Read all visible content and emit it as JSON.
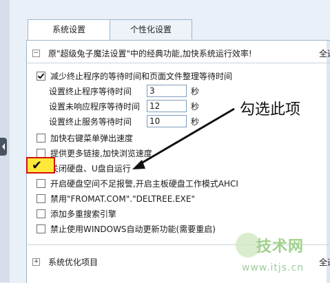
{
  "tabs": [
    {
      "label": "系统设置",
      "active": true
    },
    {
      "label": "个性化设置",
      "active": false
    }
  ],
  "section_classic": {
    "title": "原\"超级兔子魔法设置\"中的经典功能,加快系统运行效率!",
    "right_link": "全选",
    "expander": "−"
  },
  "options": {
    "reduce_wait": {
      "label": "减少终止程序的等待时间和页面文件整理等待时间",
      "checked": true
    },
    "terminate_wait": {
      "label": "设置终止程序等待时间",
      "value": "3",
      "unit": "秒"
    },
    "no_response_wait": {
      "label": "设置未响应程序等待时间",
      "value": "12",
      "unit": "秒"
    },
    "service_wait": {
      "label": "设置终止服务等待时间",
      "value": "10",
      "unit": "秒"
    },
    "right_menu": {
      "label": "加快右键菜单弹出速度",
      "checked": false
    },
    "more_links": {
      "label": "提供更多链接,加快浏览速度",
      "checked": false
    },
    "autorun": {
      "label": "关闭硬盘、U盘自运行",
      "checked": true
    },
    "disk_alert": {
      "label": "开启硬盘空间不足报警,开启主板硬盘工作模式AHCI",
      "checked": false
    },
    "disable_cmd": {
      "label": "禁用\"FROMAT.COM\".\"DELTREE.EXE\"",
      "checked": false
    },
    "multi_search": {
      "label": "添加多重搜索引擎",
      "checked": false
    },
    "windows_update": {
      "label": "禁止使用WINDOWS自动更新功能(需要重启)",
      "checked": false
    }
  },
  "section_optimize": {
    "title": "系统优化项目",
    "right_link": "全选",
    "expander": "+"
  },
  "annotation": {
    "text": "勾选此项",
    "tick": "✔"
  },
  "watermark": {
    "brand": "技术网",
    "url": "www.itjs.cn"
  },
  "colors": {
    "highlight_fill": "#ffe83a",
    "highlight_border": "#d10f0f",
    "panel_border": "#9fb3c8"
  }
}
